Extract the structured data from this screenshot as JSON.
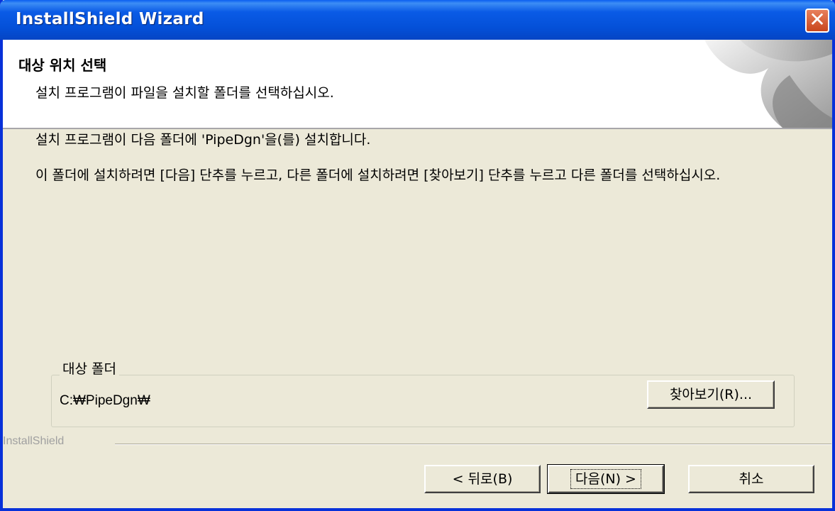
{
  "window": {
    "title": "InstallShield Wizard"
  },
  "header": {
    "title": "대상 위치 선택",
    "subtitle": "설치 프로그램이 파일을 설치할 폴더를 선택하십시오."
  },
  "body": {
    "line1": "설치 프로그램이 다음 폴더에 'PipeDgn'을(를) 설치합니다.",
    "line2": "이 폴더에 설치하려면 [다음] 단추를 누르고, 다른 폴더에 설치하려면 [찾아보기] 단추를 누르고 다른 폴더를 선택하십시오."
  },
  "destination": {
    "group_label": "대상 폴더",
    "path": "C:₩PipeDgn₩",
    "browse_label": "찾아보기(R)..."
  },
  "footer": {
    "brand": "InstallShield",
    "back_label": "< 뒤로(B)",
    "next_label": "다음(N) >",
    "cancel_label": "취소"
  },
  "icons": {
    "close": "close-icon",
    "header_art": "page-curl-art"
  },
  "colors": {
    "titlebar": "#0450d8",
    "window_bg": "#ece9d8",
    "close": "#d85a2e"
  }
}
